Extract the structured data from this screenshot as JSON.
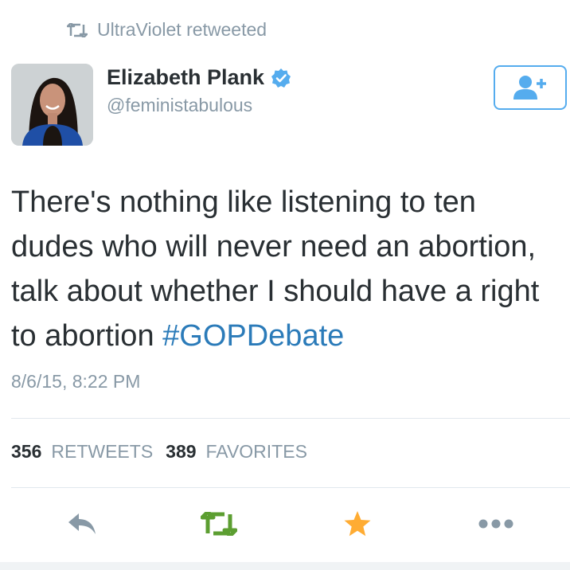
{
  "context": {
    "retweeted_by": "UltraViolet retweeted"
  },
  "author": {
    "name": "Elizabeth Plank",
    "handle": "@feministabulous",
    "verified": true
  },
  "tweet": {
    "text": "There's nothing like listening to ten dudes who will never need an abortion, talk about whether I should have a right to abortion ",
    "hashtag": "#GOPDebate",
    "timestamp": "8/6/15, 8:22 PM"
  },
  "stats": {
    "retweets_count": "356",
    "retweets_label": "RETWEETS",
    "favorites_count": "389",
    "favorites_label": "FAVORITES"
  },
  "icons": {
    "retweet": "retweet-icon",
    "verified": "verified-badge-icon",
    "follow": "follow-user-icon",
    "reply": "reply-icon",
    "favorite": "star-icon",
    "more": "more-icon"
  },
  "colors": {
    "accent": "#55acee",
    "link": "#2b7bb9",
    "muted": "#8899a6",
    "retweet_green": "#5c9e31",
    "favorite_gold": "#ffac33"
  }
}
